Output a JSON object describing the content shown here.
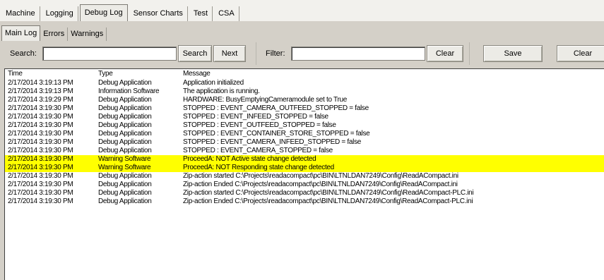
{
  "top_tabs": [
    "Machine",
    "Logging",
    "Debug Log",
    "Sensor Charts",
    "Test",
    "CSA"
  ],
  "sub_tabs": [
    "Main Log",
    "Errors",
    "Warnings"
  ],
  "toolbar": {
    "search_label": "Search:",
    "search_value": "",
    "search_button": "Search",
    "next_button": "Next",
    "filter_label": "Filter:",
    "filter_value": "",
    "filter_clear_button": "Clear",
    "save_button": "Save",
    "clear_button": "Clear"
  },
  "log": {
    "columns": [
      "Time",
      "Type",
      "Message"
    ],
    "highlight_color": "#ffff00",
    "rows": [
      {
        "time": "2/17/2014 3:19:13 PM",
        "type": "Debug Application",
        "message": "Application initialized",
        "level": "debug"
      },
      {
        "time": "2/17/2014 3:19:13 PM",
        "type": "Information Software",
        "message": "The application is running.",
        "level": "info"
      },
      {
        "time": "2/17/2014 3:19:29 PM",
        "type": "Debug Application",
        "message": "HARDWARE: BusyEmptyingCameramodule set to True",
        "level": "debug"
      },
      {
        "time": "2/17/2014 3:19:30 PM",
        "type": "Debug Application",
        "message": "STOPPED : EVENT_CAMERA_OUTFEED_STOPPED = false",
        "level": "debug"
      },
      {
        "time": "2/17/2014 3:19:30 PM",
        "type": "Debug Application",
        "message": "STOPPED : EVENT_INFEED_STOPPED = false",
        "level": "debug"
      },
      {
        "time": "2/17/2014 3:19:30 PM",
        "type": "Debug Application",
        "message": "STOPPED : EVENT_OUTFEED_STOPPED = false",
        "level": "debug"
      },
      {
        "time": "2/17/2014 3:19:30 PM",
        "type": "Debug Application",
        "message": "STOPPED : EVENT_CONTAINER_STORE_STOPPED = false",
        "level": "debug"
      },
      {
        "time": "2/17/2014 3:19:30 PM",
        "type": "Debug Application",
        "message": "STOPPED : EVENT_CAMERA_INFEED_STOPPED = false",
        "level": "debug"
      },
      {
        "time": "2/17/2014 3:19:30 PM",
        "type": "Debug Application",
        "message": "STOPPED : EVENT_CAMERA_STOPPED = false",
        "level": "debug"
      },
      {
        "time": "2/17/2014 3:19:30 PM",
        "type": "Warning Software",
        "message": "ProceedA: NOT Active state change detected",
        "level": "warning"
      },
      {
        "time": "2/17/2014 3:19:30 PM",
        "type": "Warning Software",
        "message": "ProceedA: NOT Responding state change detected",
        "level": "warning"
      },
      {
        "time": "2/17/2014 3:19:30 PM",
        "type": "Debug Application",
        "message": "Zip-action started C:\\Projects\\readacompact\\pc\\BIN\\LTNLDAN7249\\Config\\ReadACompact.ini",
        "level": "debug"
      },
      {
        "time": "2/17/2014 3:19:30 PM",
        "type": "Debug Application",
        "message": "Zip-action Ended C:\\Projects\\readacompact\\pc\\BIN\\LTNLDAN7249\\Config\\ReadACompact.ini",
        "level": "debug"
      },
      {
        "time": "2/17/2014 3:19:30 PM",
        "type": "Debug Application",
        "message": "Zip-action started C:\\Projects\\readacompact\\pc\\BIN\\LTNLDAN7249\\Config\\ReadACompact-PLC.ini",
        "level": "debug"
      },
      {
        "time": "2/17/2014 3:19:30 PM",
        "type": "Debug Application",
        "message": "Zip-action Ended C:\\Projects\\readacompact\\pc\\BIN\\LTNLDAN7249\\Config\\ReadACompact-PLC.ini",
        "level": "debug"
      }
    ]
  }
}
